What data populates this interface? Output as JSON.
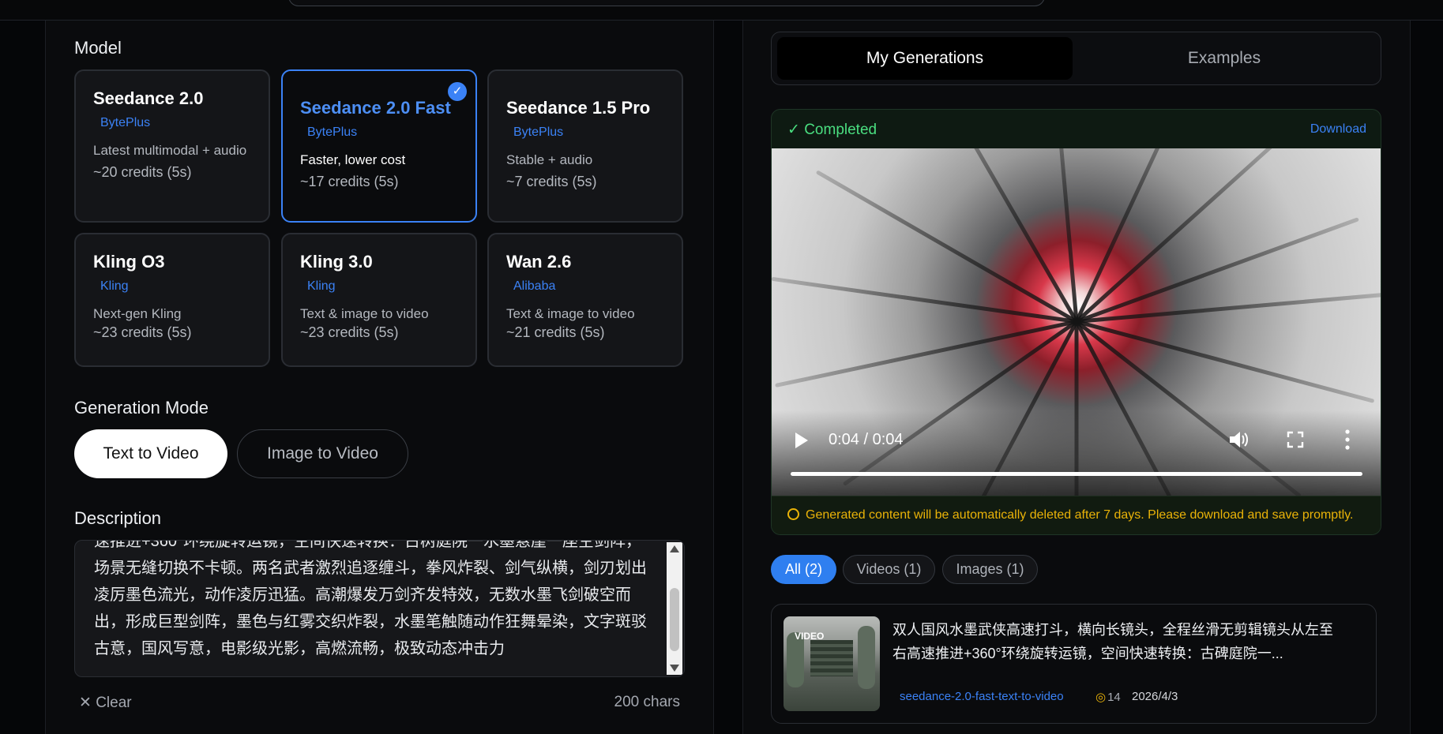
{
  "left": {
    "model_label": "Model",
    "models": [
      {
        "name": "Seedance 2.0",
        "vendor": "BytePlus",
        "desc": "Latest multimodal + audio",
        "credits": "~20 credits (5s)"
      },
      {
        "name": "Seedance 2.0 Fast",
        "vendor": "BytePlus",
        "desc": "Faster, lower cost",
        "credits": "~17 credits (5s)",
        "selected": true
      },
      {
        "name": "Seedance 1.5 Pro",
        "vendor": "BytePlus",
        "desc": "Stable + audio",
        "credits": "~7 credits (5s)"
      },
      {
        "name": "Kling O3",
        "vendor": "Kling",
        "desc": "Next-gen Kling",
        "credits": "~23 credits (5s)"
      },
      {
        "name": "Kling 3.0",
        "vendor": "Kling",
        "desc": "Text & image to video",
        "credits": "~23 credits (5s)"
      },
      {
        "name": "Wan 2.6",
        "vendor": "Alibaba",
        "desc": "Text & image to video",
        "credits": "~21 credits (5s)"
      }
    ],
    "mode_label": "Generation Mode",
    "modes": [
      "Text to Video",
      "Image to Video"
    ],
    "description_label": "Description",
    "description_text": "速推进+360°环绕旋转运镜，空间快速转换：古树庭院一水墨悬崖一座空剑阵，场景无缝切换不卡顿。两名武者激烈追逐缠斗，拳风炸裂、剑气纵横，剑刃划出凌厉墨色流光，动作凌厉迅猛。高潮爆发万剑齐发特效，无数水墨飞剑破空而出，形成巨型剑阵，墨色与红雾交织炸裂，水墨笔触随动作狂舞晕染，文字斑驳古意，国风写意，电影级光影，高燃流畅，极致动态冲击力",
    "clear_label": "Clear",
    "char_count": "200 chars"
  },
  "right": {
    "tabs": [
      "My Generations",
      "Examples"
    ],
    "status": "Completed",
    "download": "Download",
    "time": "0:04 / 0:04",
    "notice": "Generated content will be automatically deleted after 7 days. Please download and save promptly.",
    "filters": [
      "All (2)",
      "Videos (1)",
      "Images (1)"
    ],
    "item": {
      "badge": "VIDEO",
      "title": "双人国风水墨武侠高速打斗，横向长镜头，全程丝滑无剪辑镜头从左至右高速推进+360°环绕旋转运镜，空间快速转换：古碑庭院一...",
      "model": "seedance-2.0-fast-text-to-video",
      "credits": "14",
      "date": "2026/4/3"
    }
  },
  "colors": {
    "accent": "#3b82f6",
    "success": "#4ade80",
    "warning": "#eab308"
  }
}
